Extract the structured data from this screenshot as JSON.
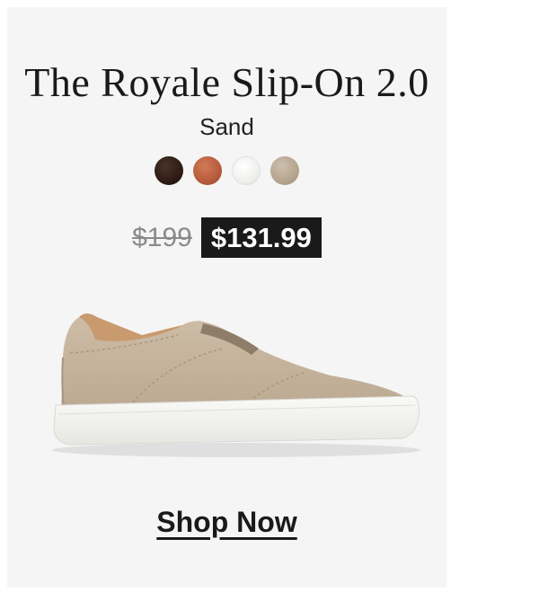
{
  "product": {
    "name": "The Royale Slip-On 2.0",
    "color_name": "Sand"
  },
  "swatches": [
    {
      "name": "dark-brown",
      "color": "#2b1a14"
    },
    {
      "name": "cognac",
      "color": "#b4583a"
    },
    {
      "name": "white",
      "color": "#f0f0ee"
    },
    {
      "name": "sand",
      "color": "#b9a893"
    }
  ],
  "pricing": {
    "original_price": "$199",
    "sale_price": "$131.99"
  },
  "cta": {
    "label": "Shop Now"
  },
  "colors": {
    "card_background": "#f5f5f5",
    "sale_badge": "#1a1a1a",
    "shoe_suede": "#c8b6a0",
    "shoe_sole": "#f4f4f2"
  }
}
